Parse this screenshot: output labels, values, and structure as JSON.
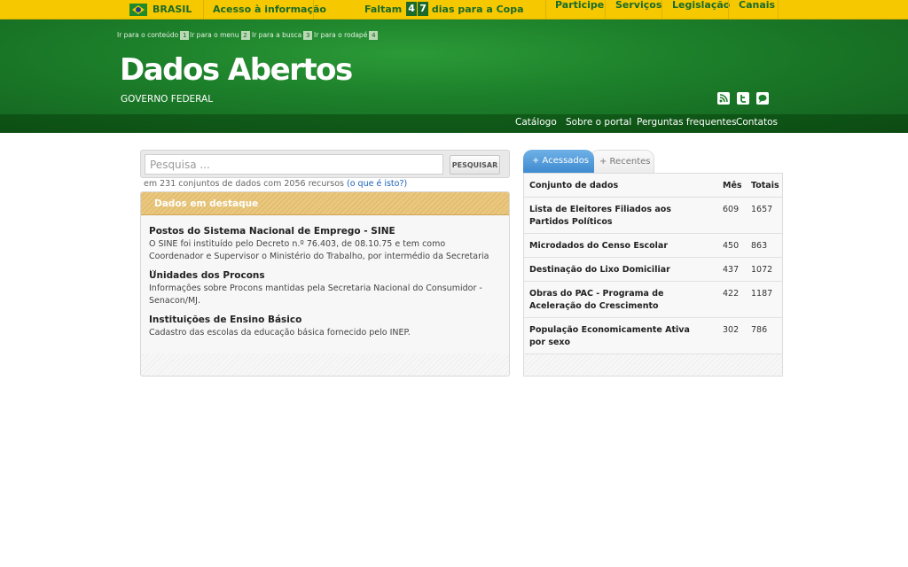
{
  "topbar": {
    "country": "BRASIL",
    "access_info": "Acesso à informação",
    "countdown_prefix": "Faltam",
    "countdown_digits": [
      "4",
      "7"
    ],
    "countdown_suffix": "dias para a Copa",
    "links": [
      "Participe",
      "Serviços",
      "Legislação",
      "Canais"
    ]
  },
  "skip_links": [
    {
      "label": "Ir para o conteúdo",
      "key": "1"
    },
    {
      "label": "Ir para o menu",
      "key": "2"
    },
    {
      "label": "Ir para a busca",
      "key": "3"
    },
    {
      "label": "Ir para o rodapé",
      "key": "4"
    }
  ],
  "header": {
    "title": "Dados Abertos",
    "subtitle": "GOVERNO FEDERAL",
    "social_icons": [
      "rss-icon",
      "twitter-icon",
      "chat-icon"
    ]
  },
  "nav": [
    "Catálogo",
    "Sobre o portal",
    "Perguntas frequentes",
    "Contatos"
  ],
  "search": {
    "placeholder": "Pesquisa ...",
    "button": "PESQUISAR",
    "meta_text": "em 231 conjuntos de dados com 2056 recursos",
    "meta_link": "(o que é isto?)"
  },
  "featured": {
    "heading": "Dados em destaque",
    "items": [
      {
        "title": "Postos do Sistema Nacional de Emprego - SINE",
        "desc": "O SINE foi instituído pelo Decreto n.º 76.403, de 08.10.75 e tem como Coordenador e Supervisor o Ministério do Trabalho, por intermédio da Secretaria ..."
      },
      {
        "title": "Unidades dos Procons",
        "desc": "Informações sobre Procons mantidas pela Secretaria Nacional do Consumidor - Senacon/MJ."
      },
      {
        "title": "Instituições de Ensino Básico",
        "desc": "Cadastro das escolas da educação básica fornecido pelo INEP."
      }
    ]
  },
  "tabs": {
    "active": "+ Acessados",
    "inactive": "+ Recentes"
  },
  "table": {
    "headers": [
      "Conjunto de dados",
      "Mês",
      "Totais"
    ],
    "rows": [
      {
        "name": "Lista de Eleitores Filiados aos Partidos Políticos",
        "month": "609",
        "total": "1657"
      },
      {
        "name": "Microdados do Censo Escolar",
        "month": "450",
        "total": "863"
      },
      {
        "name": "Destinação do Lixo Domiciliar",
        "month": "437",
        "total": "1072"
      },
      {
        "name": "Obras do PAC - Programa de Aceleração do Crescimento",
        "month": "422",
        "total": "1187"
      },
      {
        "name": "População Economicamente Ativa por sexo",
        "month": "302",
        "total": "786"
      }
    ]
  },
  "colors": {
    "topbar_yellow": "#f6c800",
    "header_green": "#1c7f2a",
    "featured_gold": "#e9c77e",
    "tab_blue": "#3e8bd0",
    "link_blue": "#1a5fb4"
  }
}
